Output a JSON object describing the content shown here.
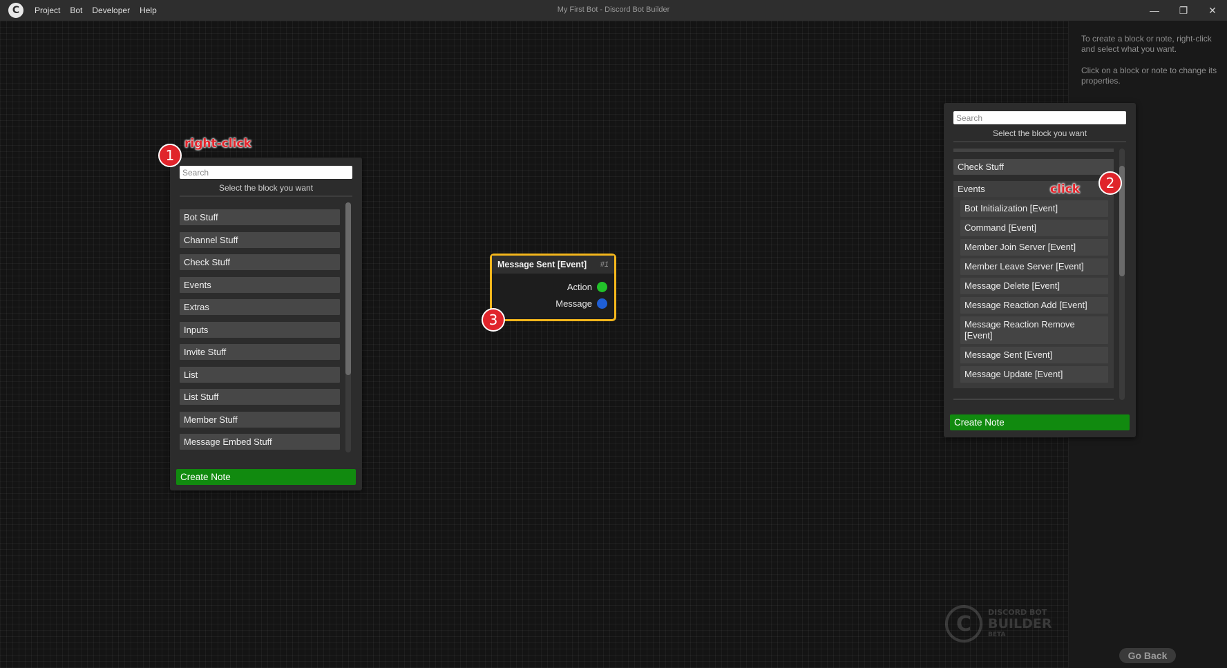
{
  "window": {
    "title": "My First Bot - Discord Bot Builder",
    "menu": [
      "Project",
      "Bot",
      "Developer",
      "Help"
    ],
    "controls": {
      "minimize": "—",
      "restore": "❐",
      "close": "✕"
    }
  },
  "help_panel": {
    "line1": "To create a block or note, right-click and select what you want.",
    "line2": "Click on a block or note to change its properties."
  },
  "left_picker": {
    "search_placeholder": "Search",
    "subtitle": "Select the block you want",
    "categories": [
      "Bot Stuff",
      "Channel Stuff",
      "Check Stuff",
      "Events",
      "Extras",
      "Inputs",
      "Invite Stuff",
      "List",
      "List Stuff",
      "Member Stuff",
      "Message Embed Stuff"
    ],
    "create_note": "Create Note"
  },
  "right_picker": {
    "search_placeholder": "Search",
    "subtitle": "Select the block you want",
    "categories": [
      "Check Stuff",
      "Events"
    ],
    "event_items": [
      "Bot Initialization [Event]",
      "Command [Event]",
      "Member Join Server [Event]",
      "Member Leave Server [Event]",
      "Message Delete [Event]",
      "Message Reaction Add [Event]",
      "Message Reaction Remove [Event]",
      "Message Sent [Event]",
      "Message Update [Event]"
    ],
    "create_note": "Create Note"
  },
  "node": {
    "title": "Message Sent [Event]",
    "id": "#1",
    "ports": [
      {
        "label": "Action",
        "color": "#22c22a"
      },
      {
        "label": "Message",
        "color": "#1f5fd6"
      }
    ]
  },
  "annotations": {
    "step1": {
      "number": "1",
      "label": "right-click"
    },
    "step2": {
      "number": "2",
      "label": "click"
    },
    "step3": {
      "number": "3"
    }
  },
  "watermark": {
    "line1": "DISCORD BOT",
    "line2": "BUILDER",
    "line3": "BETA"
  },
  "go_back": "Go Back",
  "colors": {
    "accent_green": "#118a0f",
    "node_border": "#f5b71c",
    "annotation_red": "#e0242b"
  }
}
